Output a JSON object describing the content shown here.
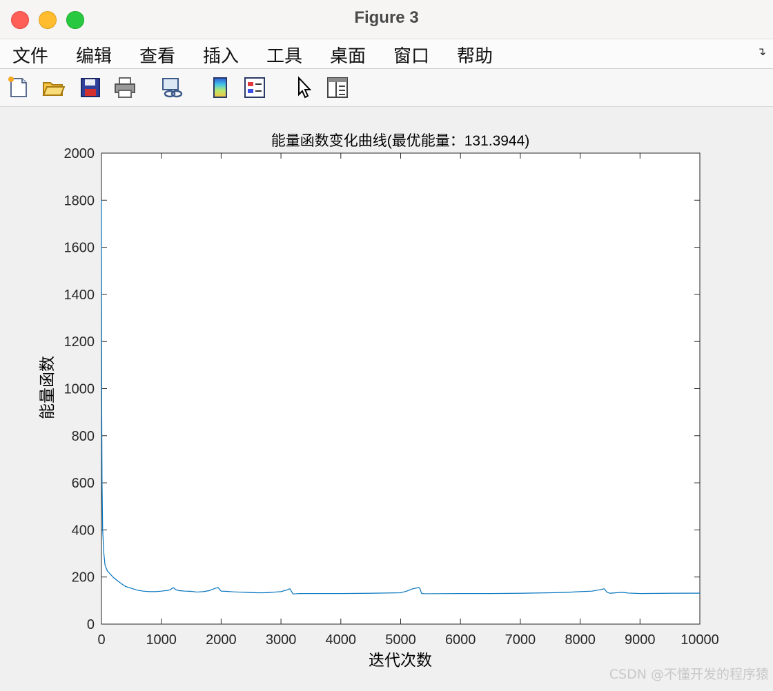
{
  "window": {
    "title": "Figure 3"
  },
  "menu": {
    "items": [
      "文件",
      "编辑",
      "查看",
      "插入",
      "工具",
      "桌面",
      "窗口",
      "帮助"
    ],
    "overflow_icon": "arrow-right-down-icon"
  },
  "toolbar": {
    "icons": [
      "new-figure-icon",
      "open-file-icon",
      "save-icon",
      "print-icon",
      "link-plot-icon",
      "colorbar-icon",
      "legend-icon",
      "pointer-icon",
      "property-inspector-icon"
    ]
  },
  "watermark": "CSDN @不懂开发的程序猿",
  "colors": {
    "line": "#0072bd",
    "axes": "#262626",
    "background": "#f0f0f0"
  },
  "chart_data": {
    "type": "line",
    "title": "能量函数变化曲线(最优能量：131.3944)",
    "xlabel": "迭代次数",
    "ylabel": "能量函数",
    "xlim": [
      0,
      10000
    ],
    "ylim": [
      0,
      2000
    ],
    "xticks": [
      0,
      1000,
      2000,
      3000,
      4000,
      5000,
      6000,
      7000,
      8000,
      9000,
      10000
    ],
    "yticks": [
      0,
      200,
      400,
      600,
      800,
      1000,
      1200,
      1400,
      1600,
      1800,
      2000
    ],
    "grid": false,
    "series": [
      {
        "x": [
          0,
          5,
          10,
          20,
          40,
          60,
          100,
          150,
          200,
          300,
          400,
          500,
          600,
          700,
          800,
          900,
          1000,
          1100,
          1150,
          1200,
          1250,
          1300,
          1400,
          1500,
          1600,
          1700,
          1800,
          1900,
          1950,
          2000,
          2100,
          2200,
          2300,
          2400,
          2500,
          2600,
          2700,
          2800,
          2900,
          3000,
          3100,
          3150,
          3200,
          3300,
          3500,
          4000,
          4500,
          5000,
          5100,
          5200,
          5300,
          5320,
          5350,
          5400,
          6000,
          6500,
          7000,
          7500,
          7800,
          8000,
          8200,
          8350,
          8400,
          8450,
          8500,
          8600,
          8700,
          8800,
          9000,
          9500,
          10000
        ],
        "y": [
          1800,
          900,
          600,
          400,
          300,
          250,
          225,
          212,
          198,
          178,
          160,
          152,
          144,
          140,
          138,
          138,
          140,
          143,
          146,
          155,
          145,
          142,
          140,
          139,
          136,
          138,
          142,
          152,
          155,
          140,
          139,
          137,
          136,
          135,
          134,
          133,
          133,
          134,
          136,
          138,
          145,
          150,
          128,
          130,
          130,
          130,
          131,
          133,
          140,
          150,
          155,
          152,
          130,
          129,
          130,
          130,
          131,
          133,
          135,
          138,
          140,
          147,
          150,
          135,
          131,
          133,
          135,
          132,
          130,
          131,
          131.4
        ]
      }
    ]
  }
}
